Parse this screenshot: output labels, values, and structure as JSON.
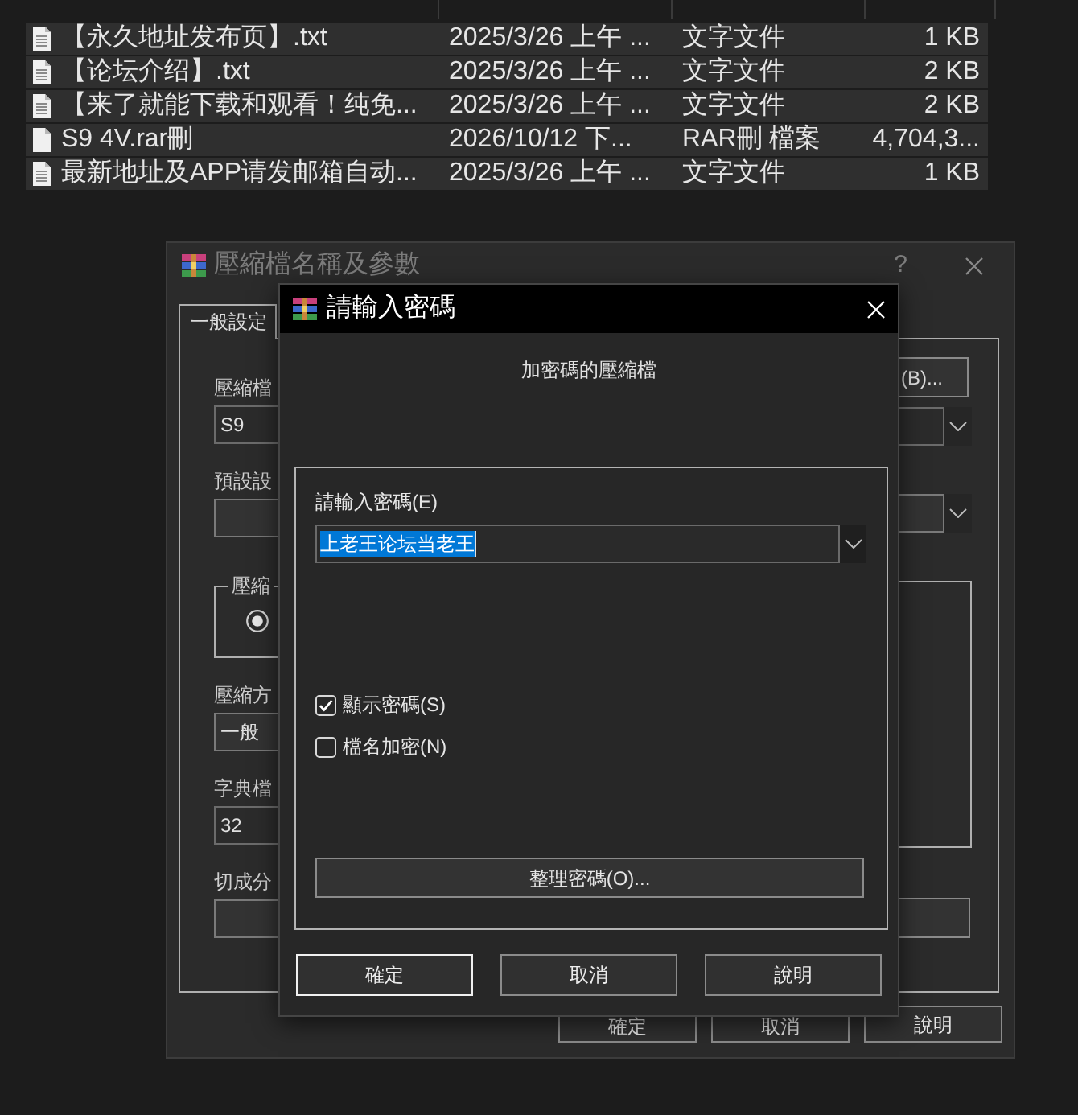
{
  "file_list": {
    "rows": [
      {
        "kind": "text",
        "name": "【永久地址发布页】.txt",
        "modified": "2025/3/26 上午 ...",
        "type": "文字文件",
        "size": "1 KB",
        "selected": true
      },
      {
        "kind": "text",
        "name": "【论坛介绍】.txt",
        "modified": "2025/3/26 上午 ...",
        "type": "文字文件",
        "size": "2 KB",
        "selected": true
      },
      {
        "kind": "text",
        "name": "【来了就能下载和观看！纯免...",
        "modified": "2025/3/26 上午 ...",
        "type": "文字文件",
        "size": "2 KB",
        "selected": true
      },
      {
        "kind": "blank",
        "name": "S9 4V.rar刪",
        "modified": "2026/10/12 下...",
        "type": "RAR刪 檔案",
        "size": "4,704,3...",
        "selected": true
      },
      {
        "kind": "text",
        "name": "最新地址及APP请发邮箱自动...",
        "modified": "2025/3/26 上午 ...",
        "type": "文字文件",
        "size": "1 KB",
        "selected": true
      }
    ]
  },
  "archive_dialog": {
    "title": "壓縮檔名稱及參數",
    "help": "?",
    "tabs": [
      {
        "label": "一般設定",
        "selected": true
      }
    ],
    "browse_button": "(B)...",
    "fields": [
      {
        "kind": "edit",
        "label": "壓縮檔",
        "value": "S9"
      },
      {
        "kind": "list",
        "label": "預設設"
      },
      {
        "kind": "radio_group",
        "label": "壓縮",
        "options": [
          {
            "selected": true
          }
        ]
      },
      {
        "kind": "list",
        "label": "壓縮方",
        "value": "一般"
      },
      {
        "kind": "edit",
        "label": "字典檔",
        "value": "32"
      },
      {
        "kind": "list",
        "label": "切成分"
      }
    ],
    "buttons": [
      {
        "label": "確定"
      },
      {
        "label": "取消"
      },
      {
        "label": "說明"
      }
    ]
  },
  "password_dialog": {
    "title": "請輸入密碼",
    "message": "加密碼的壓縮檔",
    "password_label": "請輸入密碼(E)",
    "password": {
      "value": "上老王论坛当老王",
      "selected": true
    },
    "options": [
      {
        "label": "顯示密碼(S)",
        "checked": true
      },
      {
        "label": "檔名加密(N)",
        "checked": false
      }
    ],
    "organize_button": "整理密碼(O)...",
    "buttons": [
      {
        "label": "確定",
        "default": true
      },
      {
        "label": "取消",
        "default": false
      },
      {
        "label": "說明",
        "default": false
      }
    ]
  }
}
